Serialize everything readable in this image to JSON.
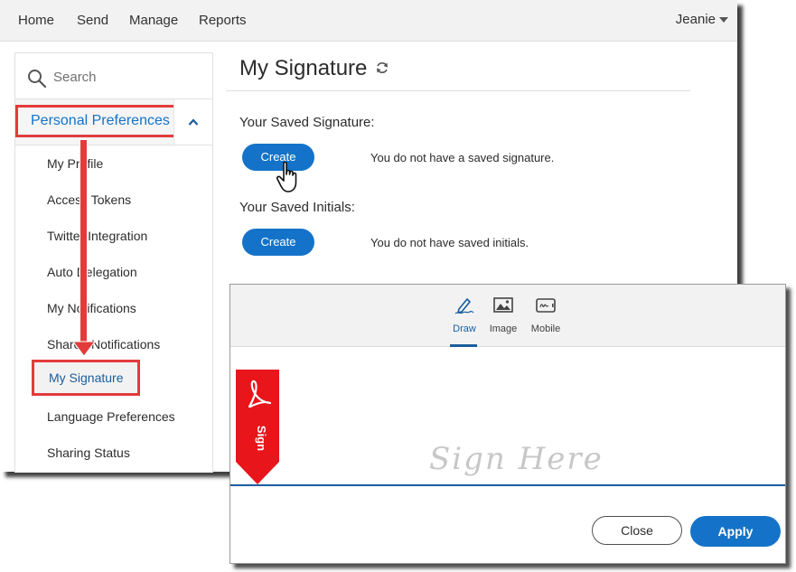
{
  "nav": {
    "items": [
      "Home",
      "Send",
      "Manage",
      "Reports"
    ],
    "user": "Jeanie"
  },
  "sidebar": {
    "search_placeholder": "Search",
    "section_title": "Personal Preferences",
    "items": [
      {
        "label": "My Profile"
      },
      {
        "label": "Access Tokens"
      },
      {
        "label": "Twitter Integration"
      },
      {
        "label": "Auto Delegation"
      },
      {
        "label": "My Notifications"
      },
      {
        "label": "Shared Notifications"
      },
      {
        "label": "My Signature"
      },
      {
        "label": "Language Preferences"
      },
      {
        "label": "Sharing Status"
      }
    ],
    "active_item": "My Signature"
  },
  "content": {
    "title": "My Signature",
    "signature_label": "Your Saved Signature:",
    "signature_button": "Create",
    "signature_message": "You do not have a saved signature.",
    "initials_label": "Your Saved Initials:",
    "initials_button": "Create",
    "initials_message": "You do not have saved initials."
  },
  "dialog": {
    "tabs": [
      {
        "label": "Draw",
        "icon": "pen-draw-icon"
      },
      {
        "label": "Image",
        "icon": "image-icon"
      },
      {
        "label": "Mobile",
        "icon": "mobile-signature-icon"
      }
    ],
    "active_tab": "Draw",
    "ribbon_text": "Sign",
    "placeholder": "Sign Here",
    "close_label": "Close",
    "apply_label": "Apply"
  },
  "colors": {
    "accent": "#1473c8",
    "highlight": "#e33b3b",
    "ribbon": "#e8151b"
  }
}
